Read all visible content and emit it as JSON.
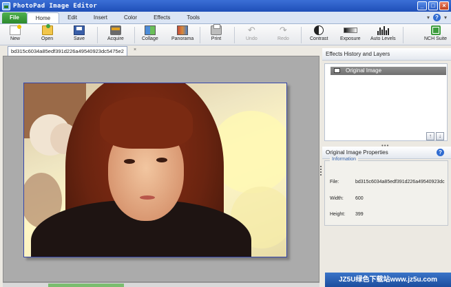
{
  "window": {
    "title": "PhotoPad Image Editor"
  },
  "menu": {
    "tabs": [
      "File",
      "Home",
      "Edit",
      "Insert",
      "Color",
      "Effects",
      "Tools"
    ],
    "active_tab": "Home"
  },
  "toolbar": {
    "new": "New",
    "open": "Open",
    "save": "Save",
    "acquire": "Acquire",
    "collage": "Collage",
    "panorama": "Panorama",
    "print": "Print",
    "undo": "Undo",
    "redo": "Redo",
    "contrast": "Contrast",
    "exposure": "Exposure",
    "auto_levels": "Auto Levels",
    "nch_suite": "NCH Suite"
  },
  "document": {
    "tab_name": "bd315c6034a85edf391d226a49540923dc5475e2"
  },
  "history_panel": {
    "title": "Effects History and Layers",
    "items": [
      "Original Image"
    ]
  },
  "properties_panel": {
    "title": "Original Image Properties",
    "section": "Information",
    "file_label": "File:",
    "file_value": "bd315c6034a85edf391d226a49540923dc",
    "width_label": "Width:",
    "width_value": "600",
    "height_label": "Height:",
    "height_value": "399"
  },
  "watermark": {
    "text": "JZ5U绿色下载站www.jz5u.com"
  },
  "icons": [
    "app-icon",
    "minimize-icon",
    "maximize-icon",
    "close-icon",
    "help-icon",
    "new-icon",
    "open-icon",
    "save-icon",
    "acquire-icon",
    "collage-icon",
    "panorama-icon",
    "print-icon",
    "undo-icon",
    "redo-icon",
    "contrast-icon",
    "exposure-icon",
    "auto-levels-icon",
    "nch-suite-icon",
    "layer-icon",
    "move-up-icon",
    "move-down-icon"
  ]
}
